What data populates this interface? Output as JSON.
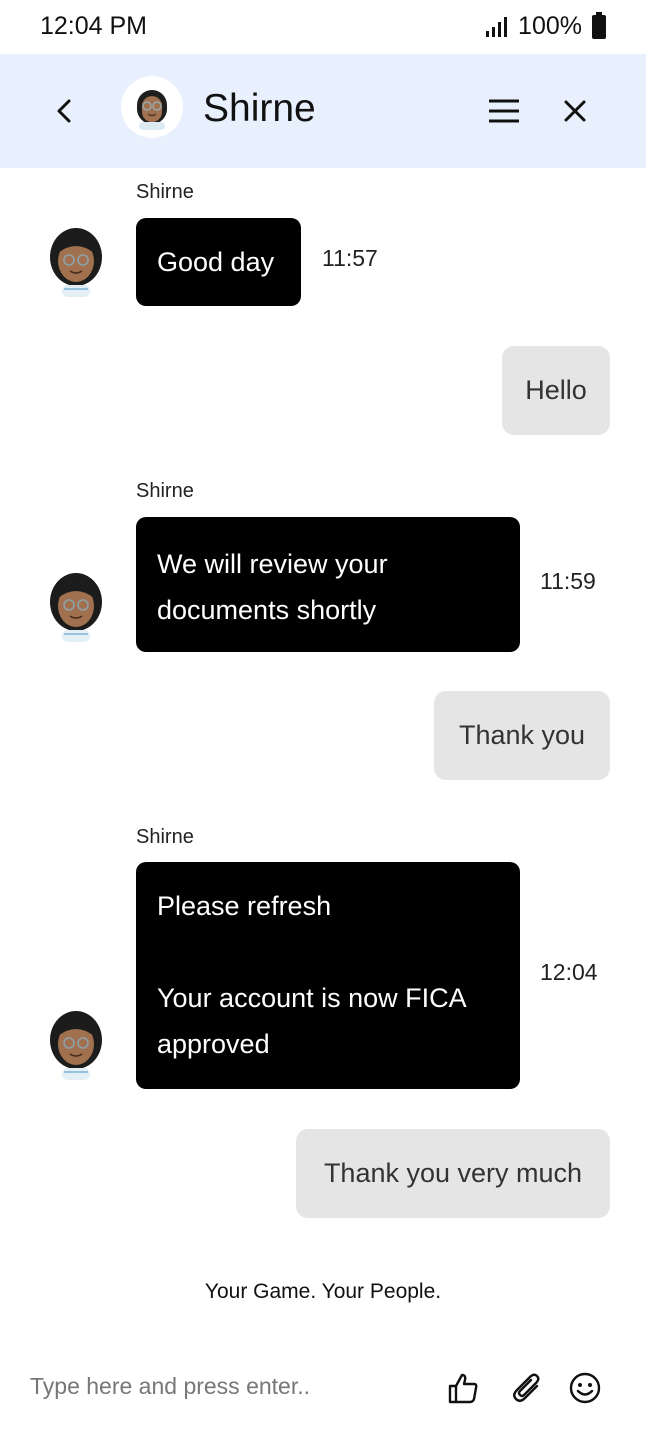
{
  "status_bar": {
    "time": "12:04 PM",
    "battery": "100%"
  },
  "header": {
    "title": "Shirne"
  },
  "messages": [
    {
      "type": "incoming",
      "sender": "Shirne",
      "lines": [
        "Good day"
      ],
      "time": "11:57"
    },
    {
      "type": "outgoing",
      "text": "Hello"
    },
    {
      "type": "incoming",
      "sender": "Shirne",
      "lines": [
        "We will review your",
        "documents shortly"
      ],
      "time": "11:59"
    },
    {
      "type": "outgoing",
      "text": "Thank you"
    },
    {
      "type": "incoming",
      "sender": "Shirne",
      "lines": [
        "Please refresh",
        "",
        "Your account is now FICA",
        "approved"
      ],
      "time": "12:04"
    },
    {
      "type": "outgoing",
      "text": "Thank you very much"
    }
  ],
  "tagline": "Your Game. Your People.",
  "composer": {
    "placeholder": "Type here and press enter.."
  },
  "icons": {
    "back": "chevron-left-icon",
    "menu": "hamburger-menu-icon",
    "close": "close-icon",
    "like": "thumbs-up-icon",
    "attach": "paperclip-icon",
    "emoji": "smiley-icon"
  }
}
